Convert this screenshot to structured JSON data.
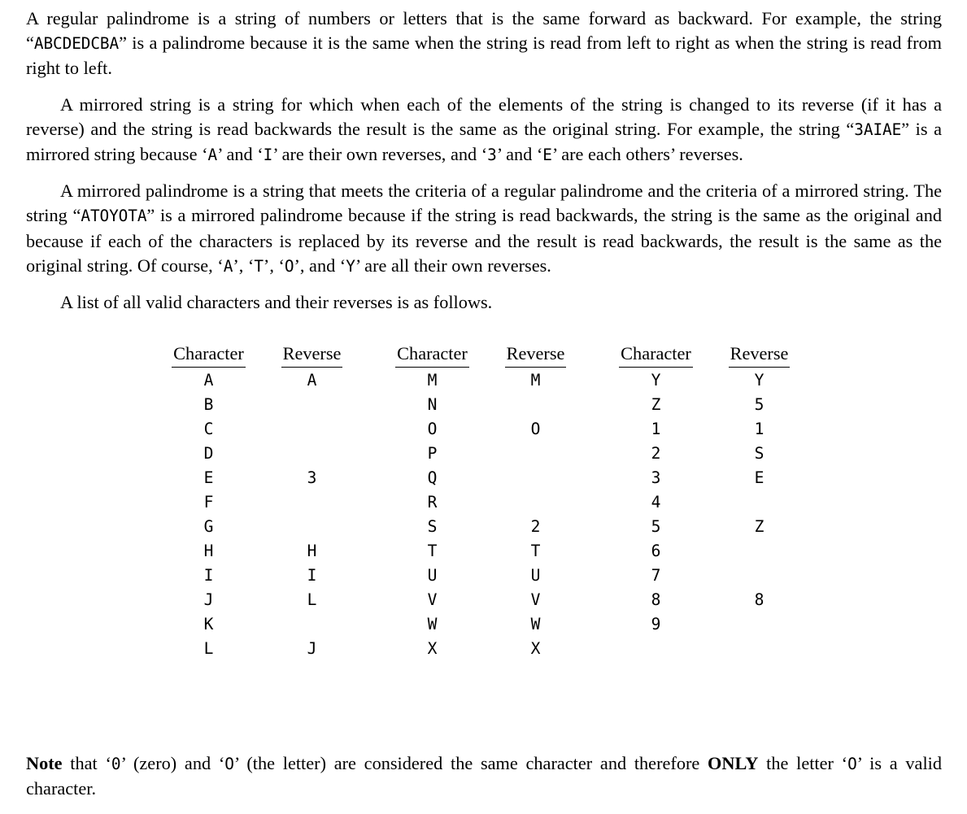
{
  "document": {
    "paragraphs": [
      {
        "id": "regular-palindrome",
        "indent": false,
        "runs": [
          {
            "t": "A regular palindrome is a string of numbers or letters that is the same forward as backward.  For example, the string “",
            "style": "normal"
          },
          {
            "t": "ABCDEDCBA",
            "style": "mono"
          },
          {
            "t": "” is a palindrome because it is the same when the string is read from left to right as when the string is read from right to left.",
            "style": "normal"
          }
        ]
      },
      {
        "id": "mirrored-string",
        "indent": true,
        "runs": [
          {
            "t": "A mirrored string is a string for which when each of the elements of the string is changed to its reverse (if it has a reverse) and the string is read backwards the result is the same as the original string. For example, the string “",
            "style": "normal"
          },
          {
            "t": "3AIAE",
            "style": "mono"
          },
          {
            "t": "” is a mirrored string because ‘",
            "style": "normal"
          },
          {
            "t": "A",
            "style": "mono"
          },
          {
            "t": "’ and ‘",
            "style": "normal"
          },
          {
            "t": "I",
            "style": "mono"
          },
          {
            "t": "’ are their own reverses, and ‘",
            "style": "normal"
          },
          {
            "t": "3",
            "style": "mono"
          },
          {
            "t": "’ and ‘",
            "style": "normal"
          },
          {
            "t": "E",
            "style": "mono"
          },
          {
            "t": "’ are each others’ reverses.",
            "style": "normal"
          }
        ]
      },
      {
        "id": "mirrored-palindrome",
        "indent": true,
        "runs": [
          {
            "t": "A mirrored palindrome is a string that meets the criteria of a regular palindrome and the criteria of a mirrored string.  The string “",
            "style": "normal"
          },
          {
            "t": "ATOYOTA",
            "style": "mono"
          },
          {
            "t": "” is a mirrored palindrome because if the string is read backwards, the string is the same as the original and because if each of the characters is replaced by its reverse and the result is read backwards, the result is the same as the original string. Of course, ‘",
            "style": "normal"
          },
          {
            "t": "A",
            "style": "mono"
          },
          {
            "t": "’, ‘",
            "style": "normal"
          },
          {
            "t": "T",
            "style": "mono"
          },
          {
            "t": "’, ‘",
            "style": "normal"
          },
          {
            "t": "O",
            "style": "mono"
          },
          {
            "t": "’, and ‘",
            "style": "normal"
          },
          {
            "t": "Y",
            "style": "mono"
          },
          {
            "t": "’ are all their own reverses.",
            "style": "normal"
          }
        ]
      },
      {
        "id": "list-intro",
        "indent": true,
        "runs": [
          {
            "t": "A list of all valid characters and their reverses is as follows.",
            "style": "normal"
          }
        ]
      }
    ],
    "note": {
      "runs": [
        {
          "t": "Note",
          "style": "bold"
        },
        {
          "t": " that ‘",
          "style": "normal"
        },
        {
          "t": "0",
          "style": "mono"
        },
        {
          "t": "’ (zero) and ‘",
          "style": "normal"
        },
        {
          "t": "O",
          "style": "mono"
        },
        {
          "t": "’ (the letter) are considered the same character and therefore ",
          "style": "normal"
        },
        {
          "t": "ONLY",
          "style": "bold"
        },
        {
          "t": " the letter ‘",
          "style": "normal"
        },
        {
          "t": "O",
          "style": "mono"
        },
        {
          "t": "’ is a valid character.",
          "style": "normal"
        }
      ]
    }
  },
  "table": {
    "headers": [
      "Character",
      "Reverse",
      "Character",
      "Reverse",
      "Character",
      "Reverse"
    ],
    "rows": [
      [
        "A",
        "A",
        "M",
        "M",
        "Y",
        "Y"
      ],
      [
        "B",
        "",
        "N",
        "",
        "Z",
        "5"
      ],
      [
        "C",
        "",
        "O",
        "O",
        "1",
        "1"
      ],
      [
        "D",
        "",
        "P",
        "",
        "2",
        "S"
      ],
      [
        "E",
        "3",
        "Q",
        "",
        "3",
        "E"
      ],
      [
        "F",
        "",
        "R",
        "",
        "4",
        ""
      ],
      [
        "G",
        "",
        "S",
        "2",
        "5",
        "Z"
      ],
      [
        "H",
        "H",
        "T",
        "T",
        "6",
        ""
      ],
      [
        "I",
        "I",
        "U",
        "U",
        "7",
        ""
      ],
      [
        "J",
        "L",
        "V",
        "V",
        "8",
        "8"
      ],
      [
        "K",
        "",
        "W",
        "W",
        "9",
        ""
      ],
      [
        "L",
        "J",
        "X",
        "X",
        "",
        ""
      ]
    ]
  }
}
